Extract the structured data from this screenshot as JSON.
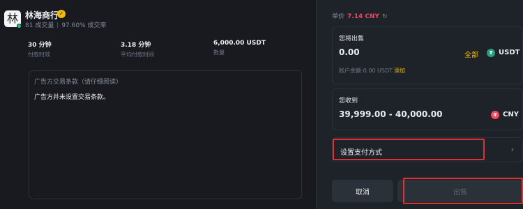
{
  "merchant": {
    "avatar_char": "林",
    "name": "林海商行",
    "trades": "81 成交量",
    "completion": "97.60% 成交率"
  },
  "stats": [
    {
      "value": "30 分钟",
      "label": "付款时效"
    },
    {
      "value": "3.18 分钟",
      "label": "平均付款时间"
    },
    {
      "value": "6,000.00 USDT",
      "label": "数量"
    }
  ],
  "terms": {
    "title": "广告方交易条款（请仔细阅读）",
    "body": "广告方并未设置交易条款。"
  },
  "order": {
    "price_label": "单价",
    "price_value": "7.14 CNY",
    "sell_label": "您将出售",
    "sell_amount": "0.00",
    "all_label": "全部",
    "sell_coin": "USDT",
    "balance_text": "账户余额:0.00 USDT",
    "topup_label": "添加",
    "receive_label": "您收到",
    "receive_amount": "39,999.00 - 40,000.00",
    "receive_coin": "CNY",
    "pay_method_label": "设置支付方式",
    "cancel_label": "取消",
    "sell_button_label": "出售"
  },
  "colors": {
    "background": "#181a20",
    "panel": "#1e2329",
    "accent": "#f0b90b",
    "price_red": "#f6465d",
    "annotation_red": "#e0302f"
  }
}
